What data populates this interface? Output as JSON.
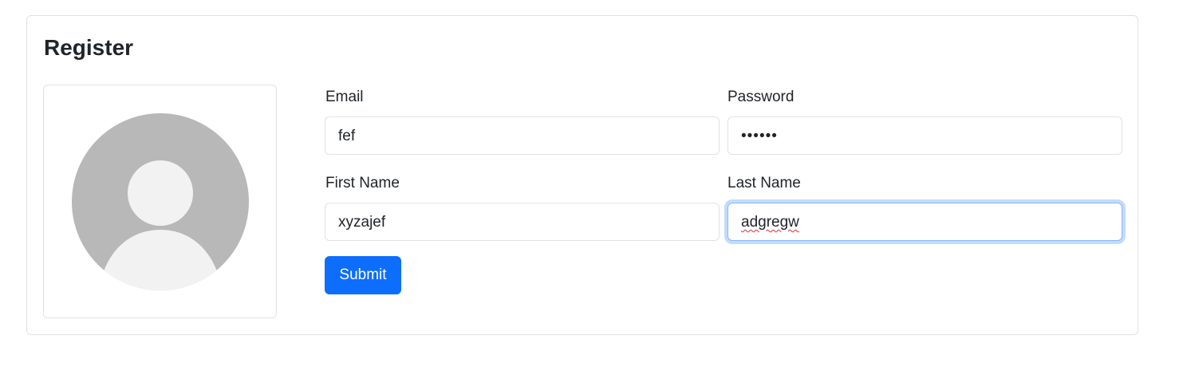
{
  "card": {
    "title": "Register"
  },
  "avatar": {
    "icon": "user-avatar-icon",
    "colors": {
      "circle": "#b8b8b8",
      "person": "#f2f2f2"
    }
  },
  "form": {
    "email": {
      "label": "Email",
      "value": "fef"
    },
    "password": {
      "label": "Password",
      "value": "••••••"
    },
    "first_name": {
      "label": "First Name",
      "value": "xyzajef"
    },
    "last_name": {
      "label": "Last Name",
      "value": "adgregw"
    },
    "submit_label": "Submit"
  },
  "colors": {
    "primary": "#0d6efd",
    "border": "#dee2e6",
    "focus_border": "#86b7fe",
    "text": "#212529"
  }
}
